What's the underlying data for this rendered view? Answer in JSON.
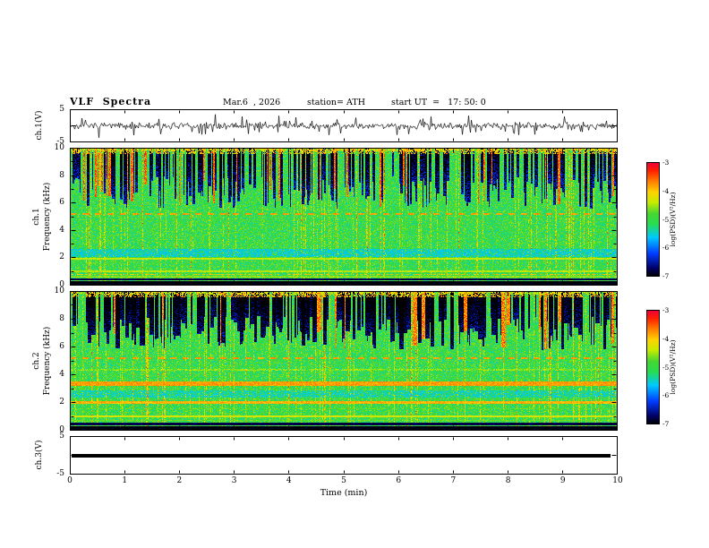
{
  "title": {
    "plot_title": "VLF  Spectra",
    "date": "Mar.6  , 2026",
    "station": "station= ATH",
    "start_ut": "start UT  =   17: 50: 0"
  },
  "xaxis": {
    "label": "Time (min)",
    "range": [
      0,
      10
    ],
    "ticks": [
      0,
      1,
      2,
      3,
      4,
      5,
      6,
      7,
      8,
      9,
      10
    ]
  },
  "colorbar": {
    "label": "log(PSD)(V²/Hz)",
    "range": [
      -7,
      -3
    ],
    "ticks": [
      -3,
      -4,
      -5,
      -6,
      -7
    ]
  },
  "chart_data": [
    {
      "id": "ch1-waveform",
      "type": "line",
      "ylabel": "ch.1(V)",
      "ylim": [
        -5,
        5
      ],
      "yticks": [
        5,
        -5
      ],
      "xlim": [
        0,
        10
      ],
      "description": "Broadband noisy voltage trace centred on 0 V with dense impulsive sferic spikes up to about ±3 V over the full 10 minutes",
      "seed": 7,
      "noise_sd": 0.5,
      "spike_rate": 0.15,
      "spike_max": 3.0
    },
    {
      "id": "ch1-spectrogram",
      "type": "heatmap",
      "ylabel_line1": "ch.1",
      "ylabel_line2": "Frequency (kHz)",
      "ylim": [
        0,
        10
      ],
      "yticks": [
        0,
        2,
        4,
        6,
        8,
        10
      ],
      "zlabel": "log(PSD)(V²/Hz)",
      "zlim": [
        -7,
        -3
      ],
      "description": "VLF power spectral density vs time: green background near -5; dense vertical sferic streaks above ~6 kHz (dark-blue dropouts with hot red tips near 10 kHz); dashed red interference line at 5.2 kHz; yellow harmonic lines near 2.0, 1.0 and 0.6 kHz; cyan band near 2.3 kHz; black band below 0.4 kHz",
      "seed": 13,
      "base_level": -5.0,
      "noise_sd": 0.3,
      "streaks": {
        "fmin": 5.6,
        "count": 260,
        "max_width": 3,
        "blue_level": -6.5,
        "hot_level": -3.6,
        "hot_fraction": 0.15
      },
      "full_streaks": 90,
      "bands": [
        {
          "f": 9.9,
          "hw": 0.12,
          "level": -4.1,
          "prob": 0.45
        },
        {
          "f": 5.2,
          "hw": 0.07,
          "level": -3.8,
          "dash": 1
        },
        {
          "f": 2.35,
          "hw": 0.3,
          "level": -5.55,
          "prob": 0.7
        },
        {
          "f": 1.95,
          "hw": 0.06,
          "level": -4.4
        },
        {
          "f": 1.0,
          "hw": 0.06,
          "level": -4.45
        },
        {
          "f": 0.8,
          "hw": 0.04,
          "level": -4.0,
          "prob": 0.5
        },
        {
          "f": 0.62,
          "hw": 0.05,
          "level": -4.6
        },
        {
          "f": 0.45,
          "hw": 0.06,
          "level": -6.8
        },
        {
          "f": 0.15,
          "hw": 0.16,
          "level": -7.0
        }
      ]
    },
    {
      "id": "ch2-spectrogram",
      "type": "heatmap",
      "ylabel_line1": "ch.2",
      "ylabel_line2": "Frequency (kHz)",
      "ylim": [
        0,
        10
      ],
      "yticks": [
        0,
        2,
        4,
        6,
        8,
        10
      ],
      "zlabel": "log(PSD)(V²/Hz)",
      "zlim": [
        -7,
        -3
      ],
      "description": "Same as ch.1 but with wider/stronger dark-blue sferic dropouts above 6 kHz, bright orange band near 3.2-3.5 kHz, red line near 2.0 kHz, extra harmonic lines below 2 kHz and black band below 0.4 kHz; dashed red line at 5.2 kHz",
      "seed": 29,
      "base_level": -5.0,
      "noise_sd": 0.3,
      "streaks": {
        "fmin": 5.8,
        "count": 300,
        "max_width": 5,
        "blue_level": -6.7,
        "hot_level": -3.7,
        "hot_fraction": 0.1
      },
      "full_streaks": 90,
      "bands": [
        {
          "f": 9.9,
          "hw": 0.1,
          "level": -4.3,
          "prob": 0.35
        },
        {
          "f": 5.2,
          "hw": 0.07,
          "level": -3.8,
          "dash": 1
        },
        {
          "f": 4.35,
          "hw": 0.05,
          "level": -4.5,
          "prob": 0.6
        },
        {
          "f": 3.35,
          "hw": 0.17,
          "level": -3.8
        },
        {
          "f": 2.6,
          "hw": 0.25,
          "level": -5.5,
          "prob": 0.6
        },
        {
          "f": 2.0,
          "hw": 0.08,
          "level": -3.9
        },
        {
          "f": 1.55,
          "hw": 0.05,
          "level": -4.7,
          "prob": 0.7
        },
        {
          "f": 1.0,
          "hw": 0.06,
          "level": -4.3
        },
        {
          "f": 0.7,
          "hw": 0.05,
          "level": -4.7
        },
        {
          "f": 0.45,
          "hw": 0.07,
          "level": -6.8
        },
        {
          "f": 0.15,
          "hw": 0.16,
          "level": -7.0
        }
      ]
    },
    {
      "id": "ch3-waveform",
      "type": "line",
      "ylabel": "ch.3(V)",
      "ylim": [
        -5,
        5
      ],
      "yticks": [
        5,
        -5
      ],
      "xlim": [
        0,
        10
      ],
      "description": "Flat thick black line at 0 V for the whole record (channel inactive)",
      "flat_value": 0
    }
  ]
}
